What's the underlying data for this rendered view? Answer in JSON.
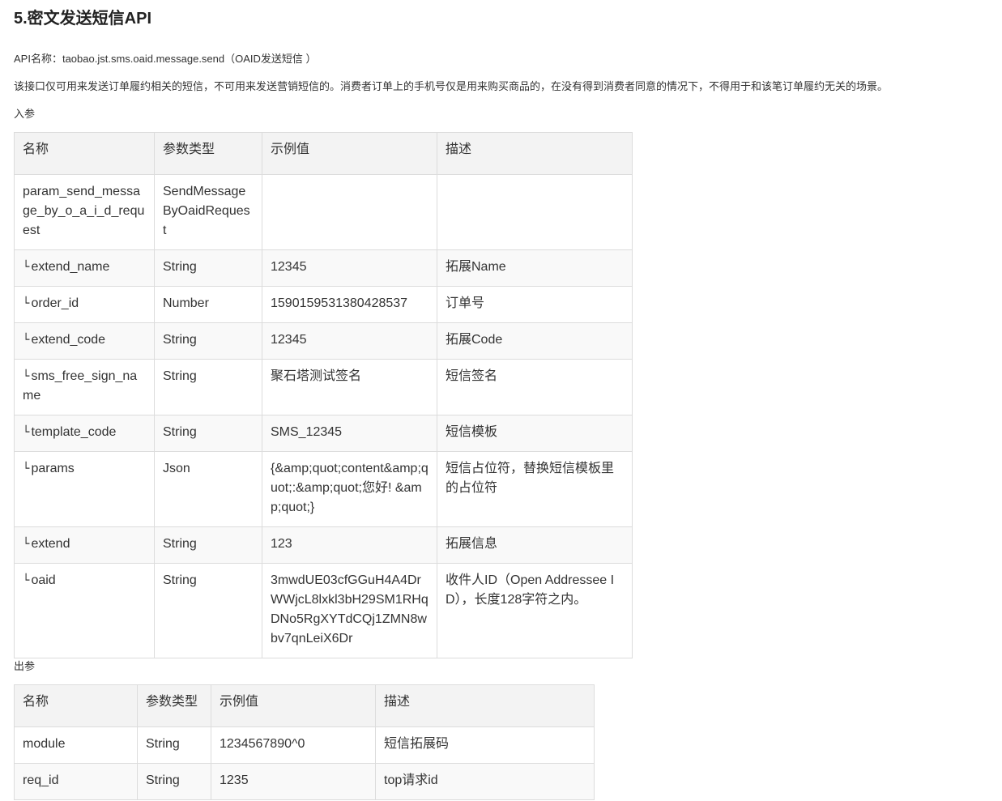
{
  "title": "5.密文发送短信API",
  "api_name": "API名称：taobao.jst.sms.oaid.message.send（OAID发送短信 ）",
  "notice": "该接口仅可用来发送订单履约相关的短信，不可用来发送营销短信的。消费者订单上的手机号仅是用来购买商品的，在没有得到消费者同意的情况下，不得用于和该笔订单履约无关的场景。",
  "input_label": "入参",
  "output_label": "出参",
  "columns": [
    "名称",
    "参数类型",
    "示例值",
    "描述"
  ],
  "sub_marker": "└",
  "input_rows": [
    {
      "name": "param_send_message_by_o_a_i_d_request",
      "type": "SendMessageByOaidRequest",
      "example": "",
      "desc": ""
    },
    {
      "name": "extend_name",
      "type": "String",
      "example": "12345",
      "desc": "拓展Name"
    },
    {
      "name": "order_id",
      "type": "Number",
      "example": "1590159531380428537",
      "desc": "订单号"
    },
    {
      "name": "extend_code",
      "type": "String",
      "example": "12345",
      "desc": "拓展Code"
    },
    {
      "name": "sms_free_sign_name",
      "type": "String",
      "example": "聚石塔测试签名",
      "desc": "短信签名"
    },
    {
      "name": "template_code",
      "type": "String",
      "example": "SMS_12345",
      "desc": "短信模板"
    },
    {
      "name": "params",
      "type": "Json",
      "example": "{&amp;quot;content&amp;quot;:&amp;quot;您好! &amp;quot;}",
      "desc": "短信占位符，替换短信模板里的占位符"
    },
    {
      "name": "extend",
      "type": "String",
      "example": "123",
      "desc": "拓展信息"
    },
    {
      "name": "oaid",
      "type": "String",
      "example": "3mwdUE03cfGGuH4A4DrWWjcL8lxkl3bH29SM1RHqDNo5RgXYTdCQj1ZMN8wbv7qnLeiX6Dr",
      "desc": "收件人ID（Open Addressee ID），长度128字符之内。"
    }
  ],
  "output_rows": [
    {
      "name": "module",
      "type": "String",
      "example": "1234567890^0",
      "desc": "短信拓展码"
    },
    {
      "name": "req_id",
      "type": "String",
      "example": "1235",
      "desc": "top请求id"
    }
  ]
}
